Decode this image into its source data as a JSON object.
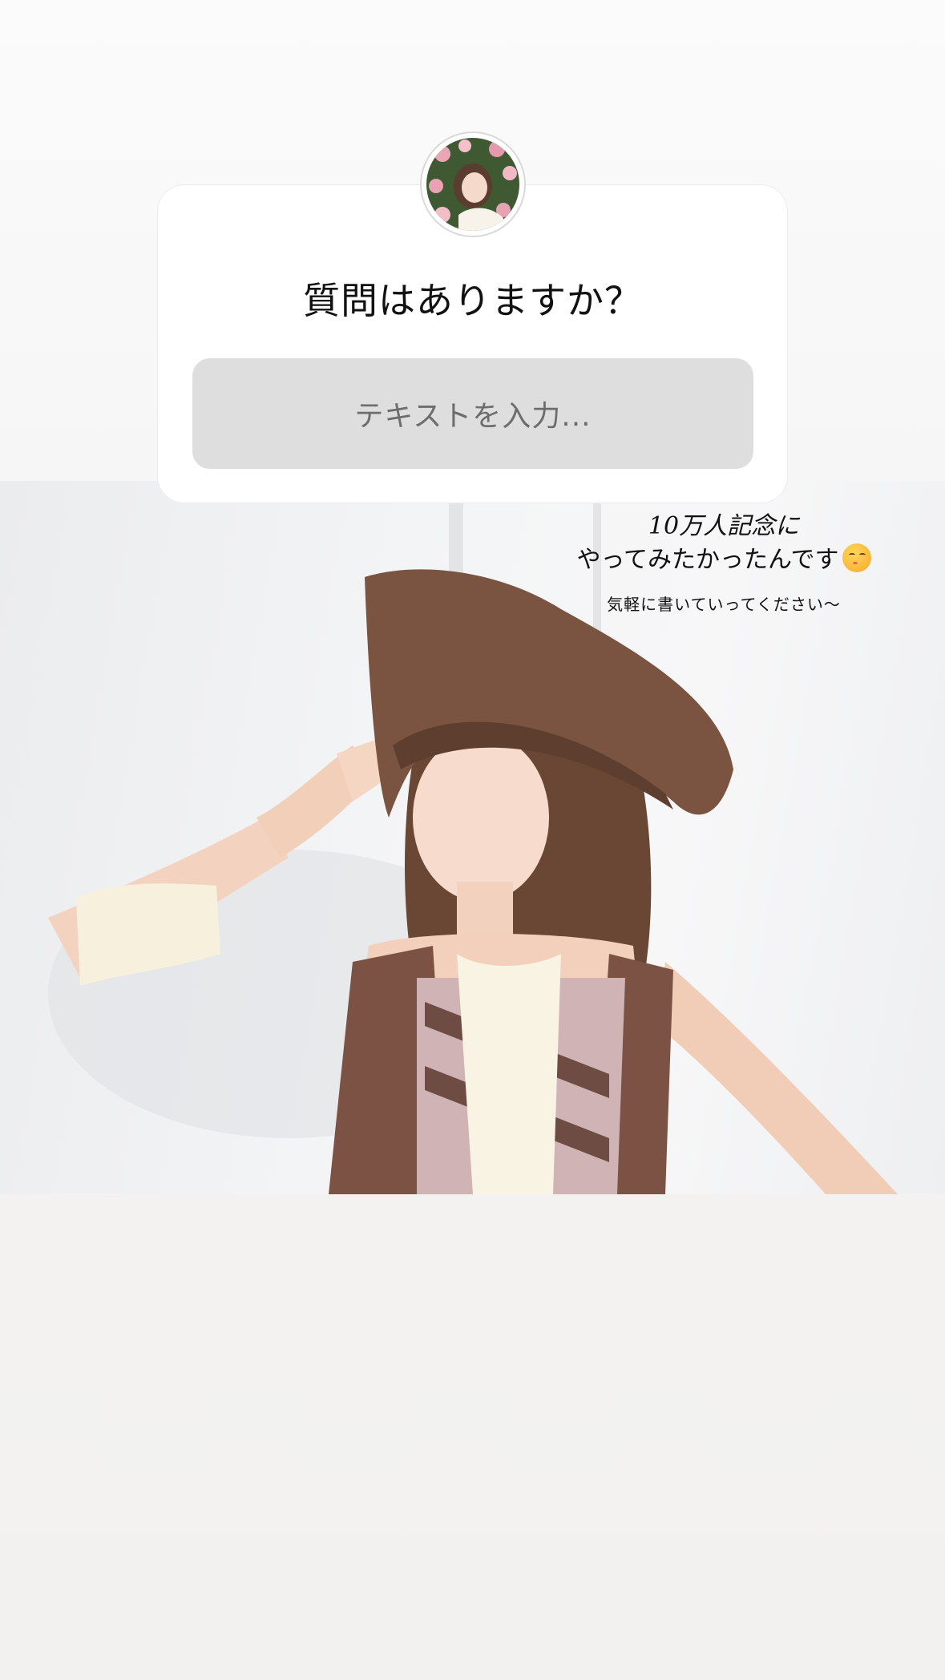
{
  "question_sticker": {
    "title": "質問はありますか？",
    "input_placeholder": "テキストを入力..."
  },
  "caption": {
    "line1": "10万人記念に",
    "line2": "やってみたかったんです",
    "line2_emoji": "kissing-face-emoji",
    "subtext": "気軽に書いていってください〜"
  },
  "colors": {
    "card_background": "#ffffff",
    "input_background": "#dedede",
    "page_background": "#f3f2f0",
    "hat_brown": "#7a5440"
  }
}
